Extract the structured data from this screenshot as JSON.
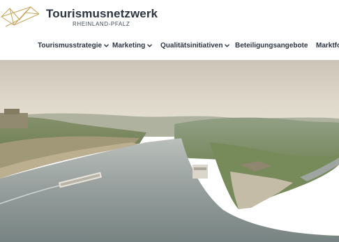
{
  "brand": {
    "title": "Tourismusnetzwerk",
    "subtitle": "RHEINLAND-PFALZ",
    "accent_color": "#c8a45a"
  },
  "nav": {
    "items": [
      {
        "label": "Tourismusstrategie",
        "has_dropdown": true
      },
      {
        "label": "Marketing",
        "has_dropdown": true
      },
      {
        "label": "Qualitätsinitiativen",
        "has_dropdown": true
      },
      {
        "label": "Beteiligungsangebote",
        "has_dropdown": false
      },
      {
        "label": "Marktfo",
        "has_dropdown": false
      }
    ],
    "chevron_icon": "chevron-down-icon"
  },
  "hero": {
    "image_icon": "aerial-river-landscape-image"
  }
}
